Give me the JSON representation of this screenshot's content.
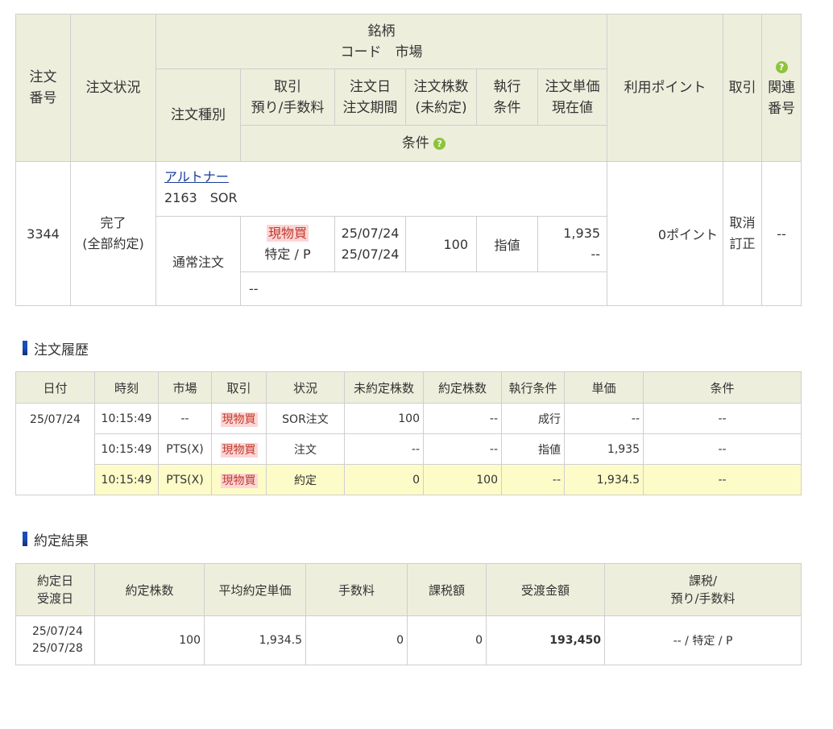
{
  "order_table": {
    "headers": {
      "order_no": [
        "注文",
        "番号"
      ],
      "status": "注文状況",
      "issue": [
        "銘柄",
        "コード　市場"
      ],
      "order_type": "注文種別",
      "trade": [
        "取引",
        "預り/手数料"
      ],
      "order_date": [
        "注文日",
        "注文期間"
      ],
      "qty": [
        "注文株数",
        "(未約定)"
      ],
      "exec": [
        "執行",
        "条件"
      ],
      "price": [
        "注文単価",
        "現在値"
      ],
      "condition": "条件",
      "points": "利用ポイント",
      "action": "取引",
      "related": [
        "関連",
        "番号"
      ]
    },
    "row": {
      "order_no": "3344",
      "status": [
        "完了",
        "(全部約定)"
      ],
      "issue_name": "アルトナー",
      "issue_code": "2163　SOR",
      "order_type": "通常注文",
      "trade_tag": "現物買",
      "trade_sub": "特定 / P",
      "order_date": "25/07/24",
      "order_period": "25/07/24",
      "qty": "100",
      "exec": "指値",
      "price": "1,935",
      "current": "--",
      "condition": "--",
      "points": "0ポイント",
      "actions": [
        "取消",
        "訂正"
      ],
      "related": "--"
    }
  },
  "history": {
    "title": "注文履歴",
    "headers": [
      "日付",
      "時刻",
      "市場",
      "取引",
      "状況",
      "未約定株数",
      "約定株数",
      "執行条件",
      "単価",
      "条件"
    ],
    "date": "25/07/24",
    "rows": [
      {
        "time": "10:15:49",
        "market": "--",
        "trade": "現物買",
        "status": "SOR注文",
        "unfilled": "100",
        "filled": "--",
        "exec": "成行",
        "price": "--",
        "cond": "--"
      },
      {
        "time": "10:15:49",
        "market": "PTS(X)",
        "trade": "現物買",
        "status": "注文",
        "unfilled": "--",
        "filled": "--",
        "exec": "指値",
        "price": "1,935",
        "cond": "--"
      },
      {
        "time": "10:15:49",
        "market": "PTS(X)",
        "trade": "現物買",
        "status": "約定",
        "unfilled": "0",
        "filled": "100",
        "exec": "--",
        "price": "1,934.5",
        "cond": "--"
      }
    ]
  },
  "result": {
    "title": "約定結果",
    "headers": {
      "dates": [
        "約定日",
        "受渡日"
      ],
      "qty": "約定株数",
      "avg": "平均約定単価",
      "fee": "手数料",
      "tax": "課税額",
      "amount": "受渡金額",
      "type": [
        "課税/",
        "預り/手数料"
      ]
    },
    "row": {
      "trade_date": "25/07/24",
      "settle_date": "25/07/28",
      "qty": "100",
      "avg": "1,934.5",
      "fee": "0",
      "tax": "0",
      "amount": "193,450",
      "type": "-- / 特定 / P"
    }
  },
  "icons": {
    "help": "question-icon"
  },
  "colors": {
    "header_bg": "#eeeedd",
    "tag_bg": "#fcd6d6",
    "tag_text": "#c0392b",
    "highlight_row": "#fdfcc8",
    "link": "#1a3c9c",
    "help_icon": "#8cc43b"
  }
}
